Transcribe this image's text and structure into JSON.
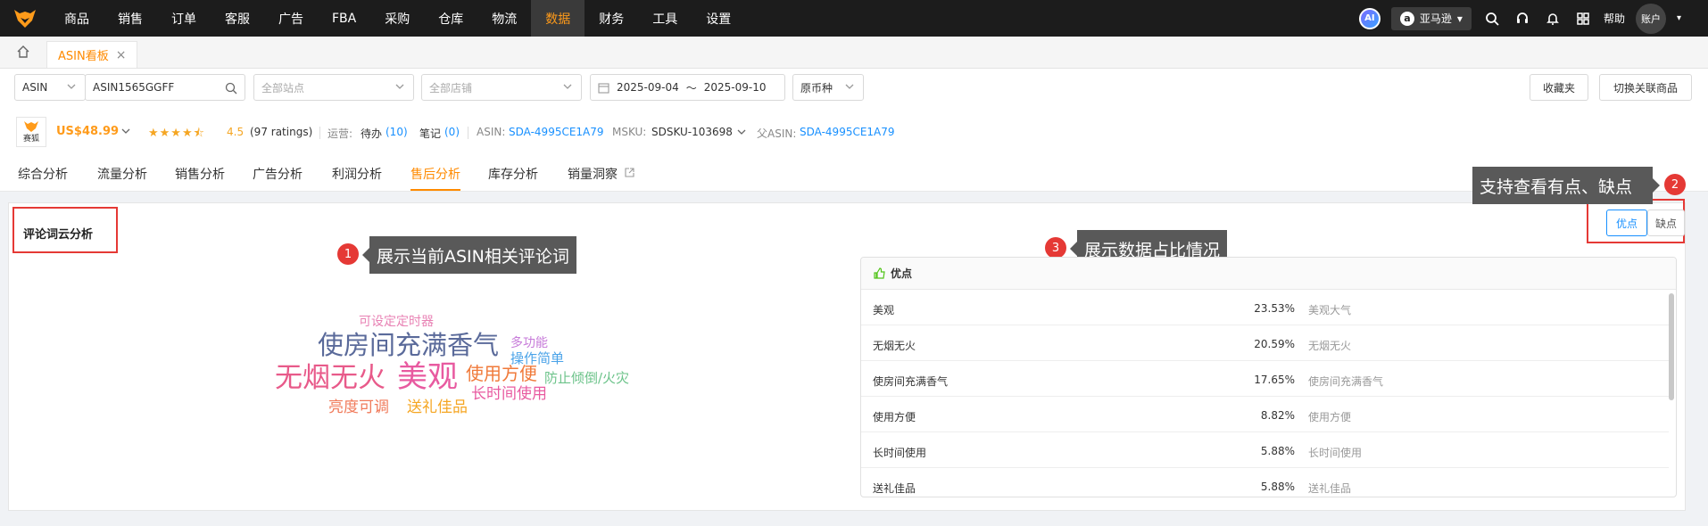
{
  "topnav": {
    "items": [
      "商品",
      "销售",
      "订单",
      "客服",
      "广告",
      "FBA",
      "采购",
      "仓库",
      "物流",
      "数据",
      "财务",
      "工具",
      "设置"
    ],
    "active_index": 9,
    "ai_label": "AI",
    "platform_label": "亚马逊",
    "help_label": "帮助",
    "account_label": "账户"
  },
  "tabs": {
    "page_tab_label": "ASIN看板",
    "close_glyph": "×"
  },
  "filters": {
    "type_value": "ASIN",
    "search_value": "ASIN1565GGFF",
    "site_placeholder": "全部站点",
    "shop_placeholder": "全部店铺",
    "date_start": "2025-09-04",
    "date_sep": "～",
    "date_end": "2025-09-10",
    "currency_value": "原币种",
    "favorites_button": "收藏夹",
    "switch_button": "切换关联商品"
  },
  "product": {
    "brand_label": "赛狐",
    "price": "US$48.99",
    "rating_stars": 4.5,
    "rating_value": "4.5",
    "ratings_count": "(97 ratings)",
    "ops_label": "运营:",
    "todo_label": "待办",
    "todo_count": "(10)",
    "notes_label": "笔记",
    "notes_count": "(0)",
    "asin_label": "ASIN:",
    "asin_value": "SDA-4995CE1A79",
    "msku_label": "MSKU:",
    "msku_value": "SDSKU-103698",
    "parent_asin_label": "父ASIN:",
    "parent_asin_value": "SDA-4995CE1A79"
  },
  "analysis_tabs": [
    "综合分析",
    "流量分析",
    "销售分析",
    "广告分析",
    "利润分析",
    "售后分析",
    "库存分析",
    "销量洞察"
  ],
  "analysis_active_index": 5,
  "panel": {
    "title": "评论词云分析",
    "pros_label": "优点",
    "cons_label": "缺点",
    "table_header": "优点"
  },
  "annotations": [
    {
      "num": "1",
      "text": "展示当前ASIN相关评论词"
    },
    {
      "num": "2",
      "text": "支持查看有点、缺点"
    },
    {
      "num": "3",
      "text": "展示数据占比情况"
    }
  ],
  "word_cloud": [
    {
      "text": "可设定定时器",
      "color": "#e882b4"
    },
    {
      "text": "使房间充满香气",
      "color": "#5a6a9a"
    },
    {
      "text": "多功能",
      "color": "#c77bd9"
    },
    {
      "text": "操作简单",
      "color": "#4aa3e8"
    },
    {
      "text": "无烟无火",
      "color": "#e85a8a"
    },
    {
      "text": "美观",
      "color": "#e85aa0"
    },
    {
      "text": "使用方便",
      "color": "#f07a3a"
    },
    {
      "text": "防止倾倒/火灾",
      "color": "#6cc38a"
    },
    {
      "text": "长时间使用",
      "color": "#e85aa0"
    },
    {
      "text": "亮度可调",
      "color": "#f07a5a"
    },
    {
      "text": "送礼佳品",
      "color": "#f5a623"
    }
  ],
  "pros_table": [
    {
      "name": "美观",
      "percent": "23.53%",
      "tag": "美观大气"
    },
    {
      "name": "无烟无火",
      "percent": "20.59%",
      "tag": "无烟无火"
    },
    {
      "name": "使房间充满香气",
      "percent": "17.65%",
      "tag": "使房间充满香气"
    },
    {
      "name": "使用方便",
      "percent": "8.82%",
      "tag": "使用方便"
    },
    {
      "name": "长时间使用",
      "percent": "5.88%",
      "tag": "长时间使用"
    },
    {
      "name": "送礼佳品",
      "percent": "5.88%",
      "tag": "送礼佳品"
    }
  ]
}
